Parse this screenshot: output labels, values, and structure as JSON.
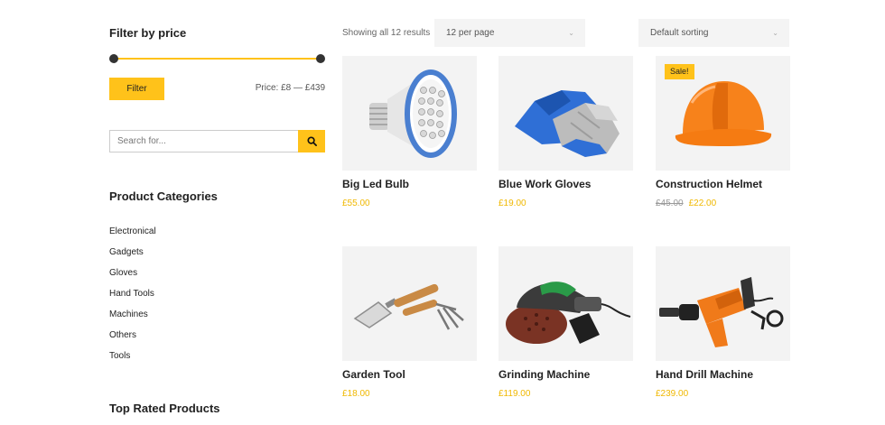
{
  "sidebar": {
    "filter_title": "Filter by price",
    "filter_button": "Filter",
    "price_range": "Price: £8 — £439",
    "search_placeholder": "Search for...",
    "categories_title": "Product Categories",
    "categories": [
      "Electronical",
      "Gadgets",
      "Gloves",
      "Hand Tools",
      "Machines",
      "Others",
      "Tools"
    ],
    "top_rated_title": "Top Rated Products"
  },
  "toolbar": {
    "result_count": "Showing all 12 results",
    "per_page": "12 per page",
    "sorting": "Default sorting"
  },
  "products": [
    {
      "name": "Big Led Bulb",
      "price": "£55.00",
      "icon": "led-bulb"
    },
    {
      "name": "Blue Work Gloves",
      "price": "£19.00",
      "icon": "work-gloves"
    },
    {
      "name": "Construction Helmet",
      "old_price": "£45.00",
      "price": "£22.00",
      "badge": "Sale!",
      "icon": "hard-hat"
    },
    {
      "name": "Garden Tool",
      "price": "£18.00",
      "icon": "garden-trowel"
    },
    {
      "name": "Grinding Machine",
      "price": "£119.00",
      "icon": "orbital-sander"
    },
    {
      "name": "Hand Drill Machine",
      "price": "£239.00",
      "icon": "power-drill"
    }
  ],
  "colors": {
    "accent": "#ffc21a",
    "price": "#f0b800"
  }
}
